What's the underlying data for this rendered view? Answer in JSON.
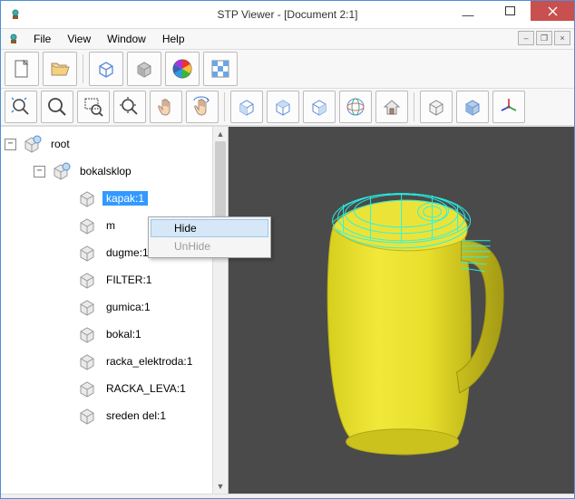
{
  "window": {
    "title": "STP Viewer - [Document 2:1]"
  },
  "menubar": {
    "file": "File",
    "view": "View",
    "window": "Window",
    "help": "Help"
  },
  "tree": {
    "root_label": "root",
    "child_label": "bokalsklop",
    "items": {
      "0": "kapak:1",
      "1": "m",
      "2": "dugme:1",
      "3": "FILTER:1",
      "4": "gumica:1",
      "5": "bokal:1",
      "6": "racka_elektroda:1",
      "7": "RACKA_LEVA:1",
      "8": "sreden del:1"
    }
  },
  "context_menu": {
    "hide": "Hide",
    "unhide": "UnHide"
  }
}
